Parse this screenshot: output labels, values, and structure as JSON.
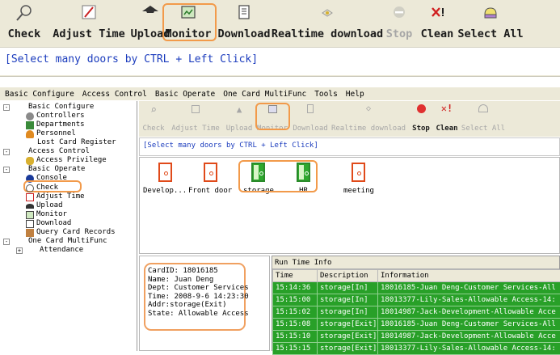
{
  "top_toolbar": {
    "buttons": [
      {
        "label": "Check",
        "icon": "magnifier-icon",
        "enabled": true
      },
      {
        "label": "Adjust Time",
        "icon": "clock-adjust-icon",
        "enabled": true
      },
      {
        "label": "Upload",
        "icon": "upload-icon",
        "enabled": true
      },
      {
        "label": "Monitor",
        "icon": "monitor-icon",
        "enabled": true,
        "highlighted": true
      },
      {
        "label": "Download",
        "icon": "download-icon",
        "enabled": true
      },
      {
        "label": "Realtime download",
        "icon": "realtime-download-icon",
        "enabled": true
      },
      {
        "label": "Stop",
        "icon": "stop-icon",
        "enabled": false
      },
      {
        "label": "Clean",
        "icon": "clean-icon",
        "enabled": true
      },
      {
        "label": "Select All",
        "icon": "select-all-icon",
        "enabled": true
      }
    ],
    "hint": "[Select many doors by CTRL + Left Click]"
  },
  "menubar": [
    "Basic Configure",
    "Access Control",
    "Basic Operate",
    "One Card MultiFunc",
    "Tools",
    "Help"
  ],
  "tree": {
    "items": [
      {
        "label": "Basic Configure",
        "level": 0,
        "toggle": "-"
      },
      {
        "label": "Controllers",
        "level": 1
      },
      {
        "label": "Departments",
        "level": 1
      },
      {
        "label": "Personnel",
        "level": 1
      },
      {
        "label": "Lost Card Register",
        "level": 1
      },
      {
        "label": "Access Control",
        "level": 0,
        "toggle": "-"
      },
      {
        "label": "Access Privilege",
        "level": 1
      },
      {
        "label": "Basic Operate",
        "level": 0,
        "toggle": "-"
      },
      {
        "label": "Console",
        "level": 1,
        "highlighted": true
      },
      {
        "label": "Check",
        "level": 1
      },
      {
        "label": "Adjust Time",
        "level": 1
      },
      {
        "label": "Upload",
        "level": 1
      },
      {
        "label": "Monitor",
        "level": 1
      },
      {
        "label": "Download",
        "level": 1
      },
      {
        "label": "Query Card Records",
        "level": 1
      },
      {
        "label": "One Card MultiFunc",
        "level": 0,
        "toggle": "-"
      },
      {
        "label": "Attendance",
        "level": 1,
        "toggle": "+"
      }
    ]
  },
  "inner_toolbar": {
    "buttons": [
      {
        "label": "Check",
        "active": false
      },
      {
        "label": "Adjust Time",
        "active": false
      },
      {
        "label": "Upload",
        "active": false
      },
      {
        "label": "Monitor",
        "active": false,
        "highlighted": true
      },
      {
        "label": "Download",
        "active": false
      },
      {
        "label": "Realtime download",
        "active": false
      },
      {
        "label": "Stop",
        "active": true
      },
      {
        "label": "Clean",
        "active": true
      },
      {
        "label": "Select All",
        "active": false
      }
    ],
    "hint": "[Select many doors by CTRL + Left Click]"
  },
  "doors": [
    {
      "label": "Develop...",
      "state": "closed"
    },
    {
      "label": "Front door",
      "state": "closed"
    },
    {
      "label": "storage",
      "state": "open"
    },
    {
      "label": "HR",
      "state": "open"
    },
    {
      "label": "meeting",
      "state": "closed"
    }
  ],
  "card_info": [
    "CardID: 18016185",
    "Name: Juan Deng",
    "Dept: Customer Services",
    "Time: 2008-9-6 14:23:30",
    "Addr:storage(Exit)",
    "State: Allowable Access"
  ],
  "runtime": {
    "title": "Run Time Info",
    "columns": [
      "Time",
      "Description",
      "Information"
    ],
    "rows": [
      [
        "15:14:36",
        "storage[In]",
        "18016185-Juan Deng-Customer Services-All"
      ],
      [
        "15:15:00",
        "storage[In]",
        "18013377-Lily-Sales-Allowable Access-14:"
      ],
      [
        "15:15:02",
        "storage[In]",
        "18014987-Jack-Development-Allowable Acce"
      ],
      [
        "15:15:08",
        "storage[Exit]",
        "18016185-Juan Deng-Customer Services-All"
      ],
      [
        "15:15:10",
        "storage[Exit]",
        "18014987-Jack-Development-Allowable Acce"
      ],
      [
        "15:15:15",
        "storage[Exit]",
        "18013377-Lily-Sales-Allowable Access-14:"
      ]
    ]
  },
  "colors": {
    "highlight": "#f29a4a",
    "row_green": "#28a028",
    "hint_blue": "#1a3bbd",
    "toolbar_bg": "#ece9d8"
  }
}
